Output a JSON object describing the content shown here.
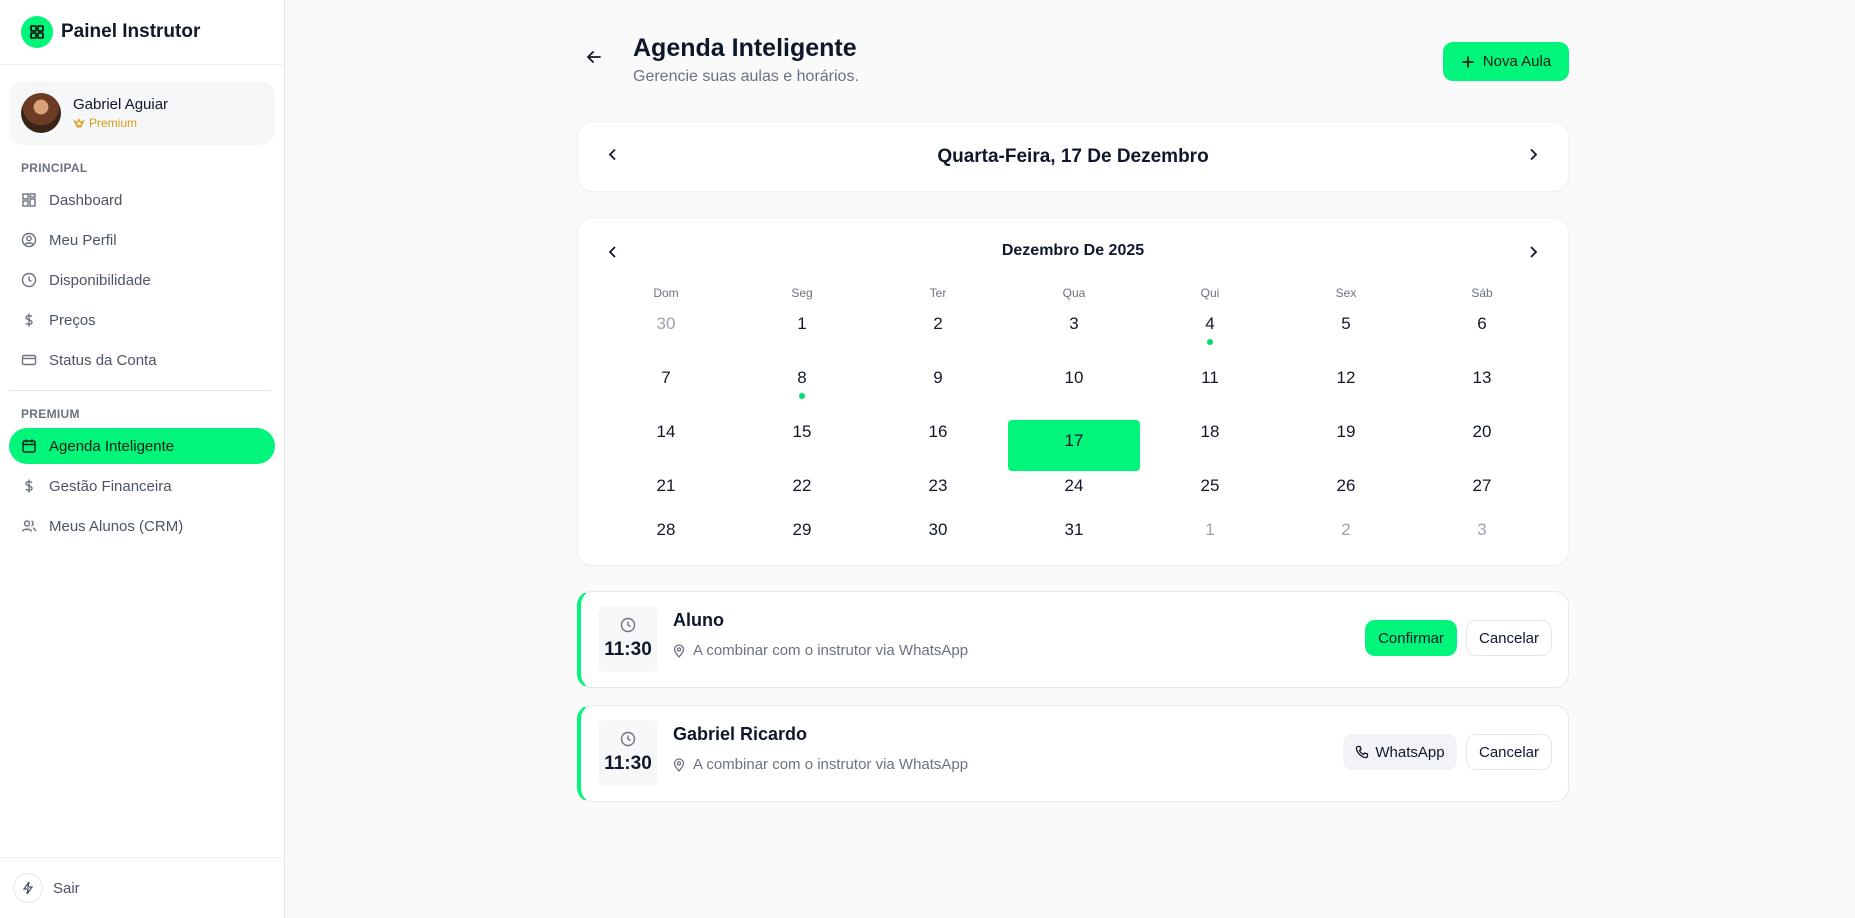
{
  "sidebar": {
    "title": "Painel Instrutor",
    "user": {
      "name": "Gabriel Aguiar",
      "badge": "Premium"
    },
    "section_principal": "PRINCIPAL",
    "principal_items": [
      {
        "label": "Dashboard",
        "icon": "grid-icon"
      },
      {
        "label": "Meu Perfil",
        "icon": "user-circle-icon"
      },
      {
        "label": "Disponibilidade",
        "icon": "clock-icon"
      },
      {
        "label": "Preços",
        "icon": "dollar-icon"
      },
      {
        "label": "Status da Conta",
        "icon": "credit-card-icon"
      }
    ],
    "section_premium": "PREMIUM",
    "premium_items": [
      {
        "label": "Agenda Inteligente",
        "icon": "calendar-icon",
        "active": true
      },
      {
        "label": "Gestão Financeira",
        "icon": "dollar-icon"
      },
      {
        "label": "Meus Alunos (CRM)",
        "icon": "users-icon"
      }
    ],
    "logout": "Sair"
  },
  "header": {
    "title": "Agenda Inteligente",
    "subtitle": "Gerencie suas aulas e horários.",
    "new_button": "Nova Aula"
  },
  "date_bar": {
    "label": "Quarta-Feira, 17 De Dezembro"
  },
  "calendar": {
    "month_label": "Dezembro De 2025",
    "weekdays": [
      "Dom",
      "Seg",
      "Ter",
      "Qua",
      "Qui",
      "Sex",
      "Sáb"
    ],
    "weeks": [
      [
        {
          "d": "30",
          "muted": true
        },
        {
          "d": "1"
        },
        {
          "d": "2"
        },
        {
          "d": "3"
        },
        {
          "d": "4",
          "dot": true
        },
        {
          "d": "5"
        },
        {
          "d": "6"
        }
      ],
      [
        {
          "d": "7"
        },
        {
          "d": "8",
          "dot": true
        },
        {
          "d": "9"
        },
        {
          "d": "10"
        },
        {
          "d": "11"
        },
        {
          "d": "12"
        },
        {
          "d": "13"
        }
      ],
      [
        {
          "d": "14"
        },
        {
          "d": "15"
        },
        {
          "d": "16"
        },
        {
          "d": "17",
          "selected": true
        },
        {
          "d": "18"
        },
        {
          "d": "19"
        },
        {
          "d": "20"
        }
      ],
      [
        {
          "d": "21"
        },
        {
          "d": "22"
        },
        {
          "d": "23"
        },
        {
          "d": "24"
        },
        {
          "d": "25"
        },
        {
          "d": "26"
        },
        {
          "d": "27"
        }
      ],
      [
        {
          "d": "28"
        },
        {
          "d": "29"
        },
        {
          "d": "30"
        },
        {
          "d": "31"
        },
        {
          "d": "1",
          "muted": true
        },
        {
          "d": "2",
          "muted": true
        },
        {
          "d": "3",
          "muted": true
        }
      ]
    ]
  },
  "appointments": [
    {
      "time": "11:30",
      "name": "Aluno",
      "location": "A combinar com o instrutor via WhatsApp",
      "primary_action": "Confirmar",
      "cancel": "Cancelar"
    },
    {
      "time": "11:30",
      "name": "Gabriel Ricardo",
      "location": "A combinar com o instrutor via WhatsApp",
      "primary_action": "WhatsApp",
      "cancel": "Cancelar"
    }
  ],
  "colors": {
    "accent": "#00f57a",
    "premium": "#d99a12"
  }
}
